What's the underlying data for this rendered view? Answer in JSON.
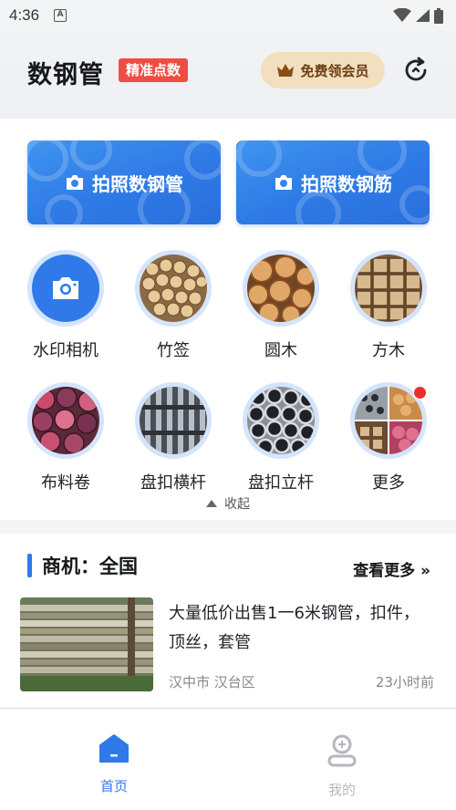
{
  "status_bar": {
    "time": "4:36",
    "notification_icon": "a-box-icon",
    "icons": [
      "wifi-icon",
      "signal-icon",
      "battery-icon"
    ]
  },
  "header": {
    "title": "数钢管",
    "badge": "精准点数",
    "vip_label": "免费领会员",
    "refresh_icon": "refresh-icon"
  },
  "actions": {
    "left_label": "拍照数钢管",
    "right_label": "拍照数钢筋"
  },
  "grid": [
    {
      "label": "水印相机",
      "icon": "camera-icon"
    },
    {
      "label": "竹签",
      "icon": "bamboo-sticks-image"
    },
    {
      "label": "圆木",
      "icon": "round-log-image"
    },
    {
      "label": "方木",
      "icon": "square-timber-image"
    },
    {
      "label": "布料卷",
      "icon": "fabric-roll-image"
    },
    {
      "label": "盘扣横杆",
      "icon": "disc-lock-crossbar-image"
    },
    {
      "label": "盘扣立杆",
      "icon": "disc-lock-upright-image"
    },
    {
      "label": "更多",
      "icon": "more-image"
    }
  ],
  "collapse_label": "收起",
  "business": {
    "title": "商机：全国",
    "more_label": "查看更多",
    "item": {
      "description": "大量低价出售1一6米钢管，扣件，顶丝，套管",
      "location": "汉中市 汉台区",
      "time": "23小时前"
    }
  },
  "tabbar": {
    "home_label": "首页",
    "mine_label": "我的"
  },
  "colors": {
    "primary": "#2f7ae8",
    "badge_red": "#ef4d44",
    "vip_bg": "#f1dfbf"
  }
}
